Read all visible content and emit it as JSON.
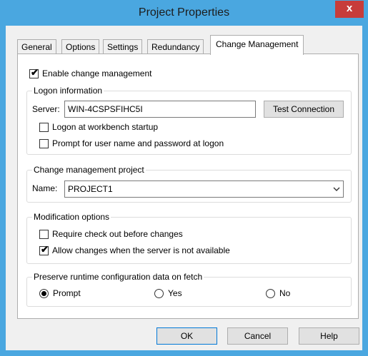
{
  "window": {
    "title": "Project Properties",
    "close_glyph": "x"
  },
  "tabs": [
    {
      "label": "General"
    },
    {
      "label": "Options"
    },
    {
      "label": "Settings"
    },
    {
      "label": "Redundancy"
    },
    {
      "label": "Change Management"
    }
  ],
  "active_tab": "Change Management",
  "enable_change_management": {
    "label": "Enable change management",
    "checked": true
  },
  "logon_information": {
    "legend": "Logon information",
    "server_label": "Server:",
    "server_value": "WIN-4CSPSFIHC5I",
    "test_connection_label": "Test Connection",
    "logon_at_startup": {
      "label": "Logon at workbench startup",
      "checked": false
    },
    "prompt_for_credentials": {
      "label": "Prompt for user name and password at logon",
      "checked": false
    }
  },
  "change_management_project": {
    "legend": "Change management project",
    "name_label": "Name:",
    "name_value": "PROJECT1"
  },
  "modification_options": {
    "legend": "Modification options",
    "require_checkout": {
      "label": "Require check out before changes",
      "checked": false
    },
    "allow_changes_offline": {
      "label": "Allow changes when the server is not available",
      "checked": true
    }
  },
  "preserve_runtime": {
    "legend": "Preserve runtime configuration data on fetch",
    "options": [
      {
        "label": "Prompt",
        "selected": true
      },
      {
        "label": "Yes",
        "selected": false
      },
      {
        "label": "No",
        "selected": false
      }
    ]
  },
  "buttons": {
    "ok": "OK",
    "cancel": "Cancel",
    "help": "Help"
  },
  "colors": {
    "title_bar": "#4aa7e0",
    "close_button": "#c73c3a",
    "dialog_background": "#f0f0f0",
    "tab_panel": "#ffffff",
    "default_button_border": "#0078d7"
  }
}
